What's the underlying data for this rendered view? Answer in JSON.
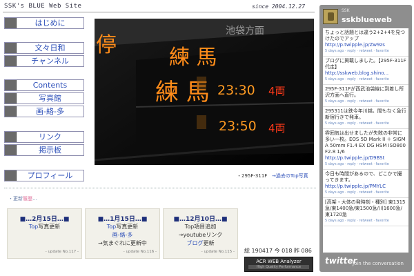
{
  "header": {
    "site_title": "SSK's BLUE Web Site",
    "since": "since 2004.12.27"
  },
  "nav": {
    "hajimeni": "はじめに",
    "diary": "文々日和",
    "channel": "チャンネル",
    "contents": "Contents",
    "photo": "写真館",
    "painting": "画-絡-多",
    "links": "リンク",
    "bbs": "掲示板",
    "profile": "プロフィール"
  },
  "photo": {
    "signs": [
      {
        "line": "練 馬",
        "time": "23:30",
        "car": "4両"
      },
      {
        "line": "練 馬",
        "time": "23:50",
        "car": "4両"
      }
    ],
    "kanji_left": "停",
    "kanji_top": "池袋方面",
    "caption_model": "・295F-311F",
    "caption_link": "→過去のTop写真"
  },
  "news": {
    "heading_prefix": "・更新",
    "heading_hl": "履歴",
    "heading_suffix": "…",
    "items": [
      {
        "date": "■…2月15日…■",
        "l1_b": "Top",
        "l1": "写真更新",
        "l2_b": "",
        "l2": "",
        "l3": "",
        "no": "- update No.117 -"
      },
      {
        "date": "■…1月15日…■",
        "l1_b": "Top",
        "l1": "写真更新",
        "l2_b": "画-絡-多",
        "l2": "",
        "l3": "→気まぐれに更新中",
        "no": "- update No.116 -"
      },
      {
        "date": "■…12月10日…■",
        "l1_b": "",
        "l1": "Top項目追加",
        "l2_b": "",
        "l2": "→youtubeリンク",
        "l3_b": "ブログ",
        "l3": "更新",
        "no": "- update No.115 -"
      }
    ]
  },
  "counter": {
    "total": "総 190417",
    "today": "今 018",
    "yesterday": "昨 086"
  },
  "acr": {
    "line1": "ACR WEB Analyzer",
    "line2": "High Quality Performance"
  },
  "twitter": {
    "handle": "SSK",
    "name": "sskblueweb",
    "logo": "twitter",
    "join": "Join the conversation",
    "meta_suffix": "days ago · reply · retweet · favorite",
    "tweets": [
      {
        "text": "ちょっと話題とは違う2+2+4を見つけたのでアップ　",
        "link": "http://p.twipple.jp/Zw9zs",
        "ago": "5"
      },
      {
        "text": "ブログに掲載しました。【295F-311F　代走】",
        "link": "http://sskweb.blog.shino...",
        "ago": "5"
      },
      {
        "text": "295F-311Fが西武池袋線に到着し所沢方面へ直行。",
        "link": "",
        "ago": "5"
      },
      {
        "text": "295311は鉄今年川越。間もなく急行新宿行きで発車。",
        "link": "",
        "ago": "5"
      },
      {
        "text": "雰囲気は出せましたが失敗の非常に多い一枚。EOS 5D Mark II ＋ SIGMA 50mm F1.4 EX DG HSM ISO800 F2.8 1/6",
        "link": "http://p.twipple.jp/D9BSt",
        "ago": "5"
      },
      {
        "text": "今日も時間があるので、どこかで撮ってきます。",
        "link": "http://p.twipple.jp/PMYLC",
        "ago": "5"
      },
      {
        "text": "[高架・大体の発時刻・種別] 東1315急/東1400急/東1500急/川1600急/東1720急",
        "link": "",
        "ago": "5"
      }
    ]
  }
}
